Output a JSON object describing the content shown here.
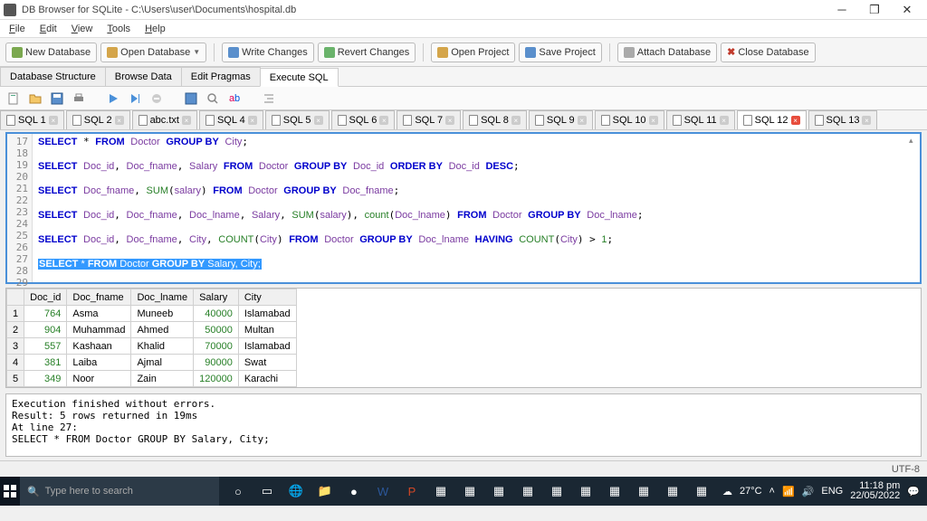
{
  "title": "DB Browser for SQLite - C:\\Users\\user\\Documents\\hospital.db",
  "menu": [
    "File",
    "Edit",
    "View",
    "Tools",
    "Help"
  ],
  "toolbar": {
    "new_db": "New Database",
    "open_db": "Open Database",
    "write": "Write Changes",
    "revert": "Revert Changes",
    "open_proj": "Open Project",
    "save_proj": "Save Project",
    "attach": "Attach Database",
    "close_db": "Close Database"
  },
  "dbtabs": {
    "structure": "Database Structure",
    "browse": "Browse Data",
    "pragmas": "Edit Pragmas",
    "execute": "Execute SQL"
  },
  "sqltabs": [
    "SQL 1",
    "SQL 2",
    "abc.txt",
    "SQL 4",
    "SQL 5",
    "SQL 6",
    "SQL 7",
    "SQL 8",
    "SQL 9",
    "SQL 10",
    "SQL 11",
    "SQL 12",
    "SQL 13"
  ],
  "active_sqltab": 11,
  "gutter": [
    "17",
    "18",
    "19",
    "20",
    "21",
    "22",
    "23",
    "24",
    "25",
    "26",
    "27",
    "28",
    "29"
  ],
  "headers": [
    "Doc_id",
    "Doc_fname",
    "Doc_lname",
    "Salary",
    "City"
  ],
  "rows": [
    {
      "n": "1",
      "doc_id": "764",
      "fn": "Asma",
      "ln": "Muneeb",
      "sal": "40000",
      "city": "Islamabad"
    },
    {
      "n": "2",
      "doc_id": "904",
      "fn": "Muhammad",
      "ln": "Ahmed",
      "sal": "50000",
      "city": "Multan"
    },
    {
      "n": "3",
      "doc_id": "557",
      "fn": "Kashaan",
      "ln": "Khalid",
      "sal": "70000",
      "city": "Islamabad"
    },
    {
      "n": "4",
      "doc_id": "381",
      "fn": "Laiba",
      "ln": "Ajmal",
      "sal": "90000",
      "city": "Swat"
    },
    {
      "n": "5",
      "doc_id": "349",
      "fn": "Noor",
      "ln": "Zain",
      "sal": "120000",
      "city": "Karachi"
    }
  ],
  "log": "Execution finished without errors.\nResult: 5 rows returned in 19ms\nAt line 27:\nSELECT * FROM Doctor GROUP BY Salary, City;",
  "encoding": "UTF-8",
  "tray": {
    "weather": "27°C",
    "time": "11:18 pm",
    "date": "22/05/2022"
  },
  "search_placeholder": "Type here to search"
}
